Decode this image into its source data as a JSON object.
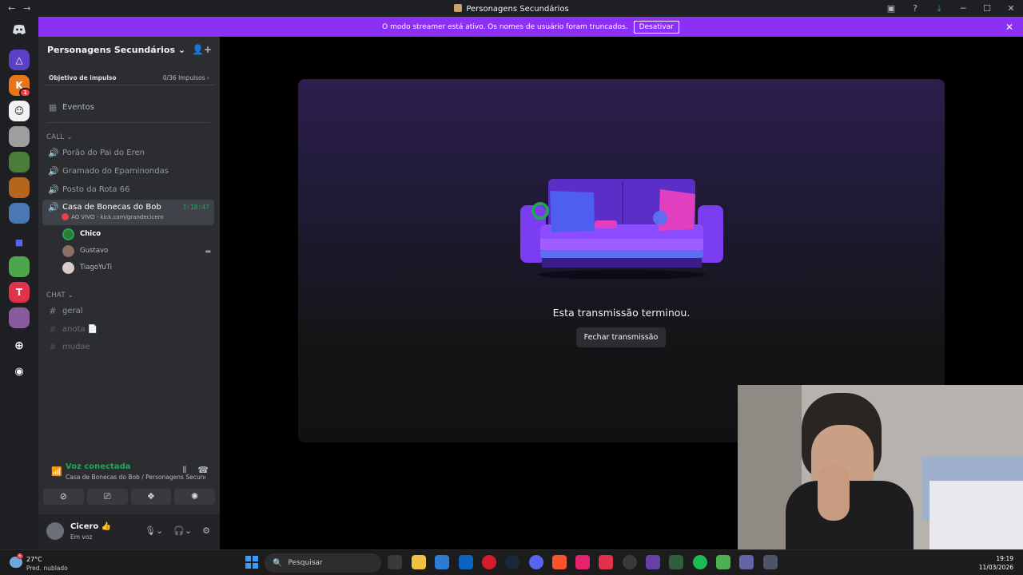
{
  "window": {
    "title": "Personagens Secundários",
    "back": "←",
    "forward": "→"
  },
  "banner": {
    "text": "O modo streamer está ativo. Os nomes de usuário foram truncados.",
    "button": "Desativar",
    "close": "✕"
  },
  "guilds": [
    {
      "badge": ""
    },
    {
      "badge": "1"
    },
    {
      "badge": ""
    },
    {
      "badge": ""
    },
    {
      "badge": ""
    },
    {
      "badge": ""
    },
    {
      "badge": ""
    }
  ],
  "server": {
    "name": "Personagens Secundários ⌄",
    "boost_label": "Objetivo de impulso",
    "boost_value": "0/36 Impulsos ›",
    "events": "Eventos"
  },
  "categories": {
    "call": "CALL ⌄",
    "chat": "CHAT ⌄"
  },
  "voice_channels": [
    {
      "name": "Porão do Pai do Eren"
    },
    {
      "name": "Gramado do Epaminondas"
    },
    {
      "name": "Posto da Rota 66"
    }
  ],
  "active_channel": {
    "name": "Casa de Bonecas do Bob",
    "timer": "3:18:47",
    "live": "AO VIVO - kick.com/grandecicero"
  },
  "voice_users": [
    {
      "name": "Chico"
    },
    {
      "name": "Gustavo"
    },
    {
      "name": "TiagoYuTi"
    }
  ],
  "text_channels": [
    {
      "name": "geral"
    },
    {
      "name": "anota 📄"
    },
    {
      "name": "mudae"
    }
  ],
  "voice_status": {
    "title": "Voz conectada",
    "location": "Casa de Bonecas do Bob / Personagens Secund..."
  },
  "user": {
    "name": "Cicero 👍",
    "status": "Em voz"
  },
  "stream": {
    "message": "Esta transmissão terminou.",
    "close_button": "Fechar transmissão"
  },
  "taskbar": {
    "temperature": "27°C",
    "condition": "Pred. nublado",
    "weather_badge": "6",
    "search_placeholder": "Pesquisar",
    "time": "19:19",
    "date": "11/03/2026"
  },
  "colors": {
    "accent": "#8c30f5",
    "voice_green": "#23a559",
    "sidebar": "#2b2d31",
    "rail": "#1e1f22"
  }
}
